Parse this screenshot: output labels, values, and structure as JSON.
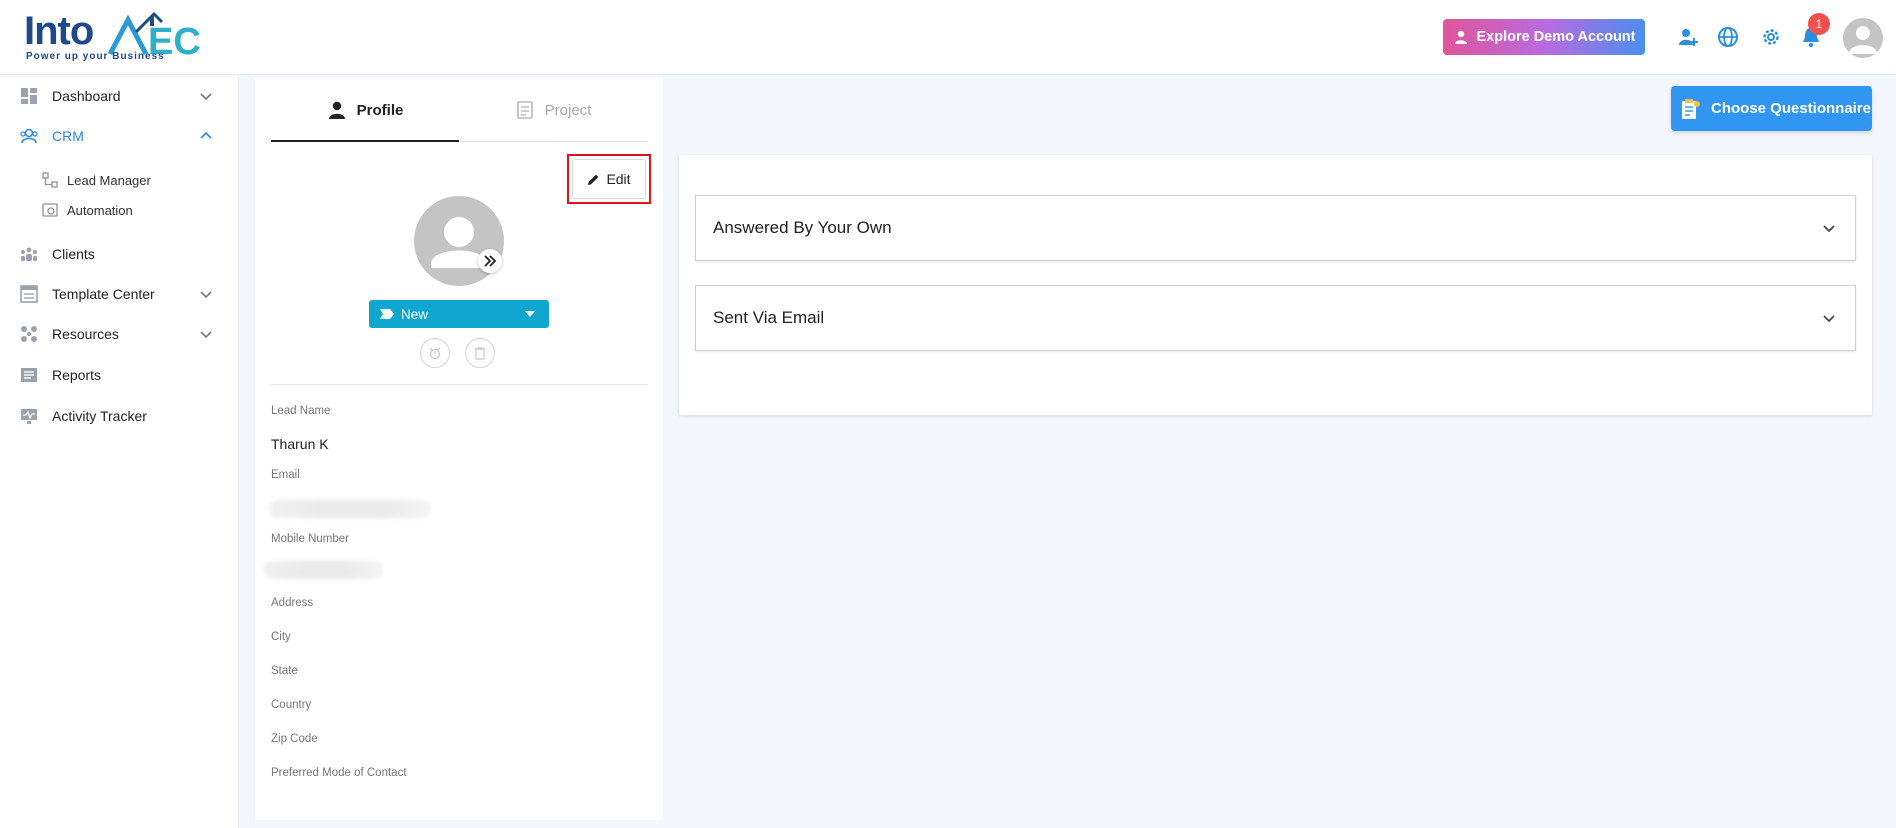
{
  "brand": {
    "logo_text": "IntoAEC",
    "tagline": "Power up your Business"
  },
  "header": {
    "demo_button_label": "Explore Demo Account",
    "notification_count": "1",
    "icons": [
      "add-user-icon",
      "globe-icon",
      "gear-icon",
      "bell-icon",
      "user-avatar-icon"
    ]
  },
  "sidebar": {
    "items": [
      {
        "label": "Dashboard",
        "icon": "dashboard-icon",
        "chevron": "down"
      },
      {
        "label": "CRM",
        "icon": "crm-icon",
        "chevron": "up",
        "active": true
      },
      {
        "label": "Clients",
        "icon": "clients-icon"
      },
      {
        "label": "Template Center",
        "icon": "template-icon",
        "chevron": "down"
      },
      {
        "label": "Resources",
        "icon": "resources-icon",
        "chevron": "down"
      },
      {
        "label": "Reports",
        "icon": "reports-icon"
      },
      {
        "label": "Activity Tracker",
        "icon": "activity-icon"
      }
    ],
    "crm_sub_items": [
      {
        "label": "Lead Manager",
        "icon": "lead-manager-icon"
      },
      {
        "label": "Automation",
        "icon": "automation-icon"
      }
    ]
  },
  "profile": {
    "tabs": [
      {
        "label": "Profile",
        "icon": "person-icon",
        "active": true
      },
      {
        "label": "Project",
        "icon": "project-icon",
        "active": false
      }
    ],
    "edit_label": "Edit",
    "status_value": "New",
    "fields": [
      {
        "label": "Lead Name",
        "value": "Tharun K"
      },
      {
        "label": "Email",
        "value": ""
      },
      {
        "label": "Mobile Number",
        "value": ""
      },
      {
        "label": "Address",
        "value": ""
      },
      {
        "label": "City",
        "value": ""
      },
      {
        "label": "State",
        "value": ""
      },
      {
        "label": "Country",
        "value": ""
      },
      {
        "label": "Zip Code",
        "value": ""
      },
      {
        "label": "Preferred Mode of Contact",
        "value": ""
      }
    ]
  },
  "questionnaire": {
    "choose_button_label": "Choose Questionnaire",
    "sections": [
      {
        "title": "Answered By Your Own"
      },
      {
        "title": "Sent Via Email"
      }
    ]
  },
  "colors": {
    "accent_blue": "#3096f1",
    "status_teal": "#0fa7cf",
    "crm_active": "#2f88d8",
    "notification_red": "#f0514f",
    "highlight_red": "#e0121a"
  }
}
